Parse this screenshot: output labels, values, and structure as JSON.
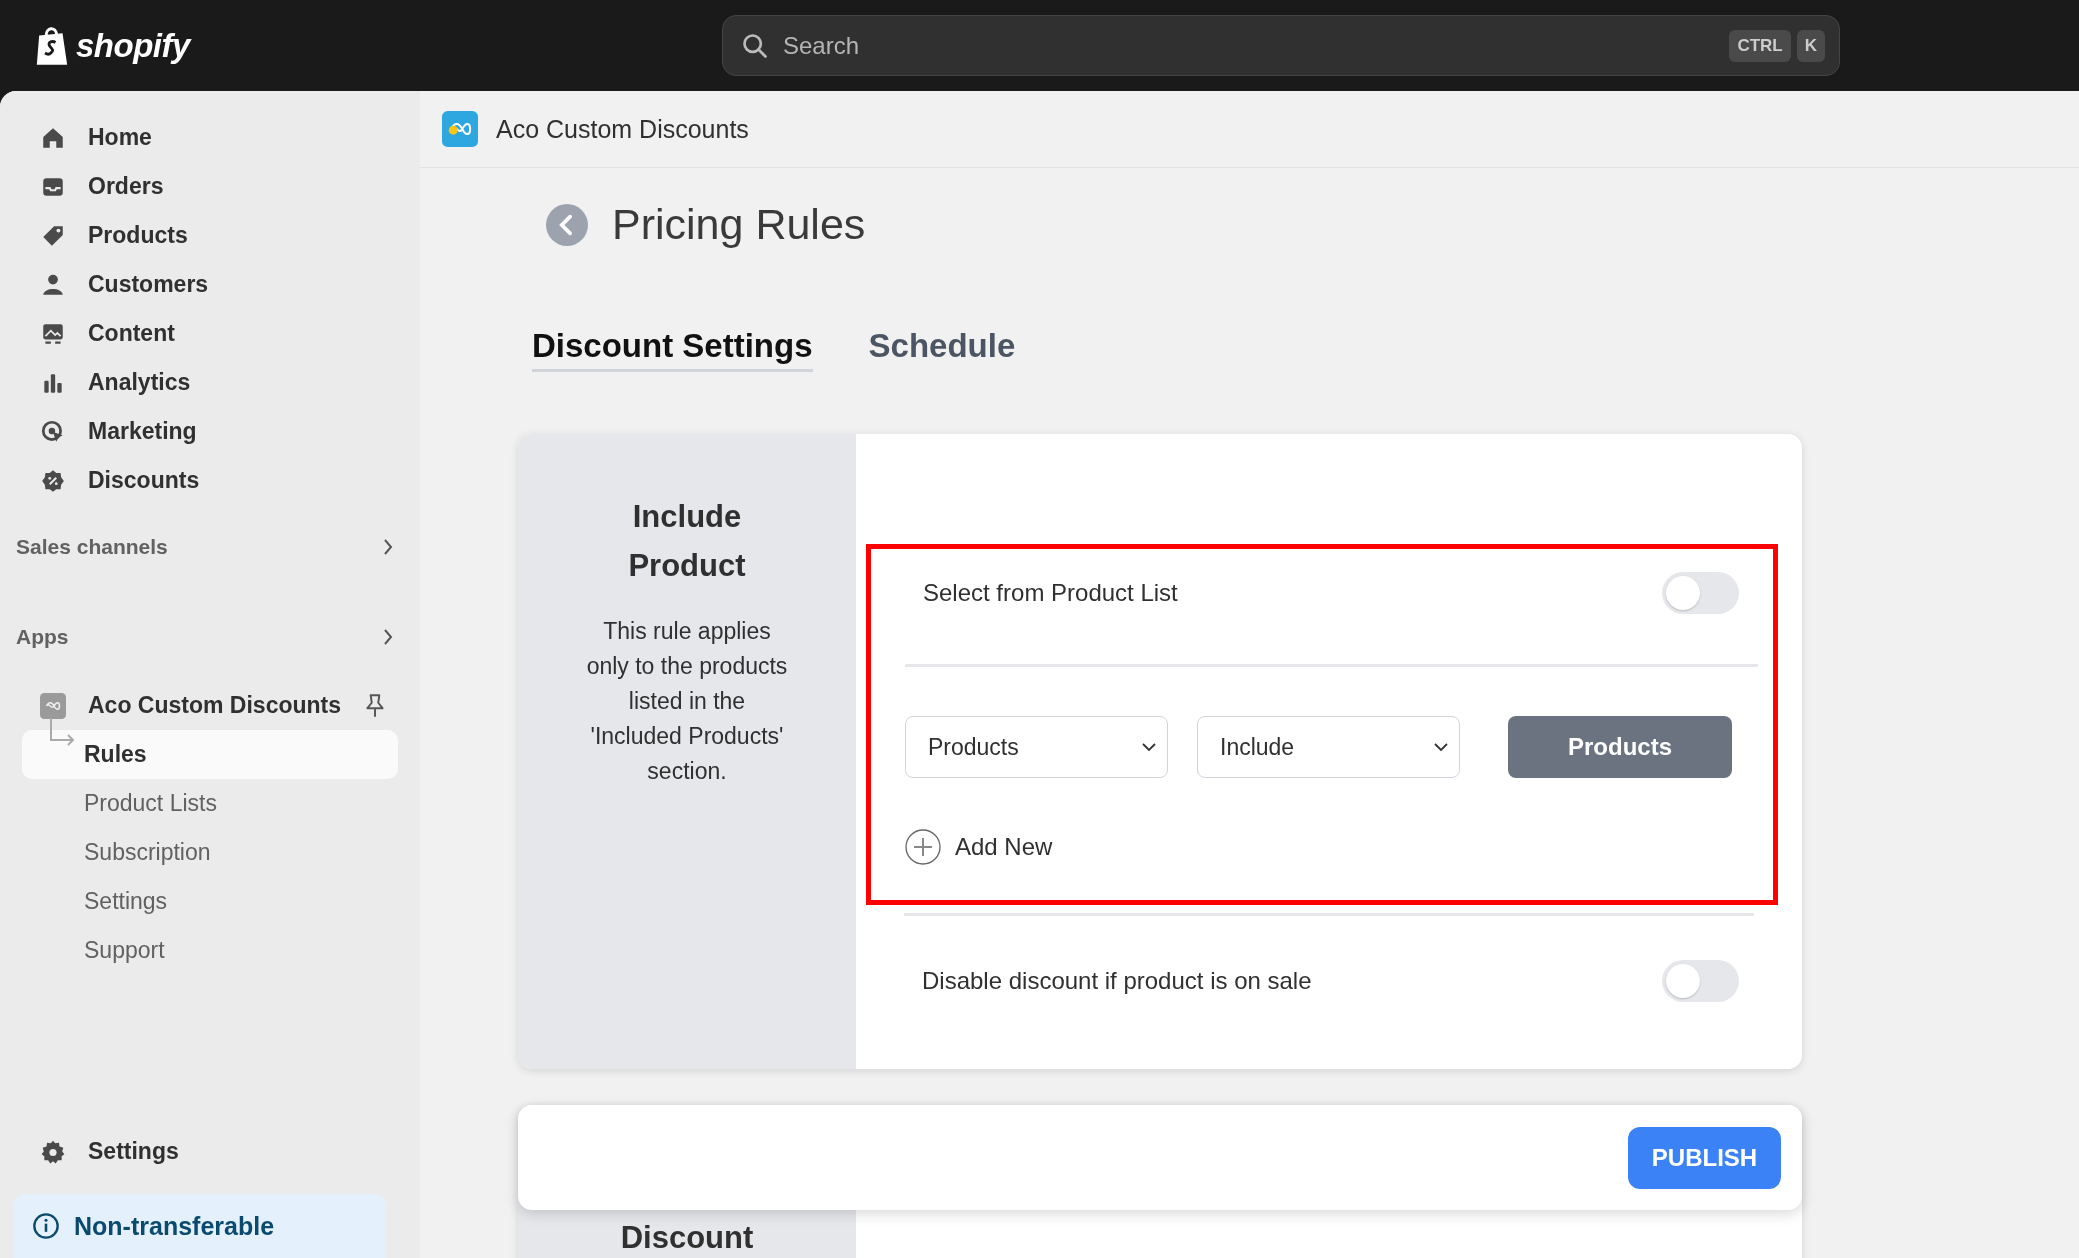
{
  "topbar": {
    "logo": "shopify",
    "search": {
      "placeholder": "Search"
    },
    "shortcut": [
      "CTRL",
      "K"
    ]
  },
  "sidebar": {
    "items": [
      {
        "label": "Home",
        "selected": false
      },
      {
        "label": "Orders",
        "selected": false
      },
      {
        "label": "Products",
        "selected": false
      },
      {
        "label": "Customers",
        "selected": false
      },
      {
        "label": "Content",
        "selected": false
      },
      {
        "label": "Analytics",
        "selected": false
      },
      {
        "label": "Marketing",
        "selected": false
      },
      {
        "label": "Discounts",
        "selected": false
      }
    ],
    "sections": [
      "Sales channels",
      "Apps"
    ],
    "app": {
      "name": "Aco Custom Discounts",
      "subitems": [
        {
          "label": "Rules",
          "selected": true
        },
        {
          "label": "Product Lists",
          "selected": false
        },
        {
          "label": "Subscription",
          "selected": false
        },
        {
          "label": "Settings",
          "selected": false
        },
        {
          "label": "Support",
          "selected": false
        }
      ]
    },
    "settings": "Settings",
    "notice": "Non-transferable"
  },
  "app_header": {
    "title": "Aco Custom Discounts"
  },
  "page": {
    "title": "Pricing Rules",
    "tabs": [
      {
        "label": "Discount Settings",
        "selected": true
      },
      {
        "label": "Schedule",
        "selected": false
      }
    ]
  },
  "rule_card": {
    "title": "Include Product",
    "description": "This rule applies only to the products listed in the 'Included Products' section.",
    "select_from_list": {
      "label": "Select from Product List",
      "on": false
    },
    "condition": {
      "field": "Products",
      "operator": "Include",
      "button": "Products"
    },
    "add_new": "Add New",
    "disable_on_sale": {
      "label": "Disable discount if product is on sale",
      "on": false
    }
  },
  "publish_bar": {
    "button": "PUBLISH"
  },
  "next_card": {
    "title": "Discount"
  }
}
